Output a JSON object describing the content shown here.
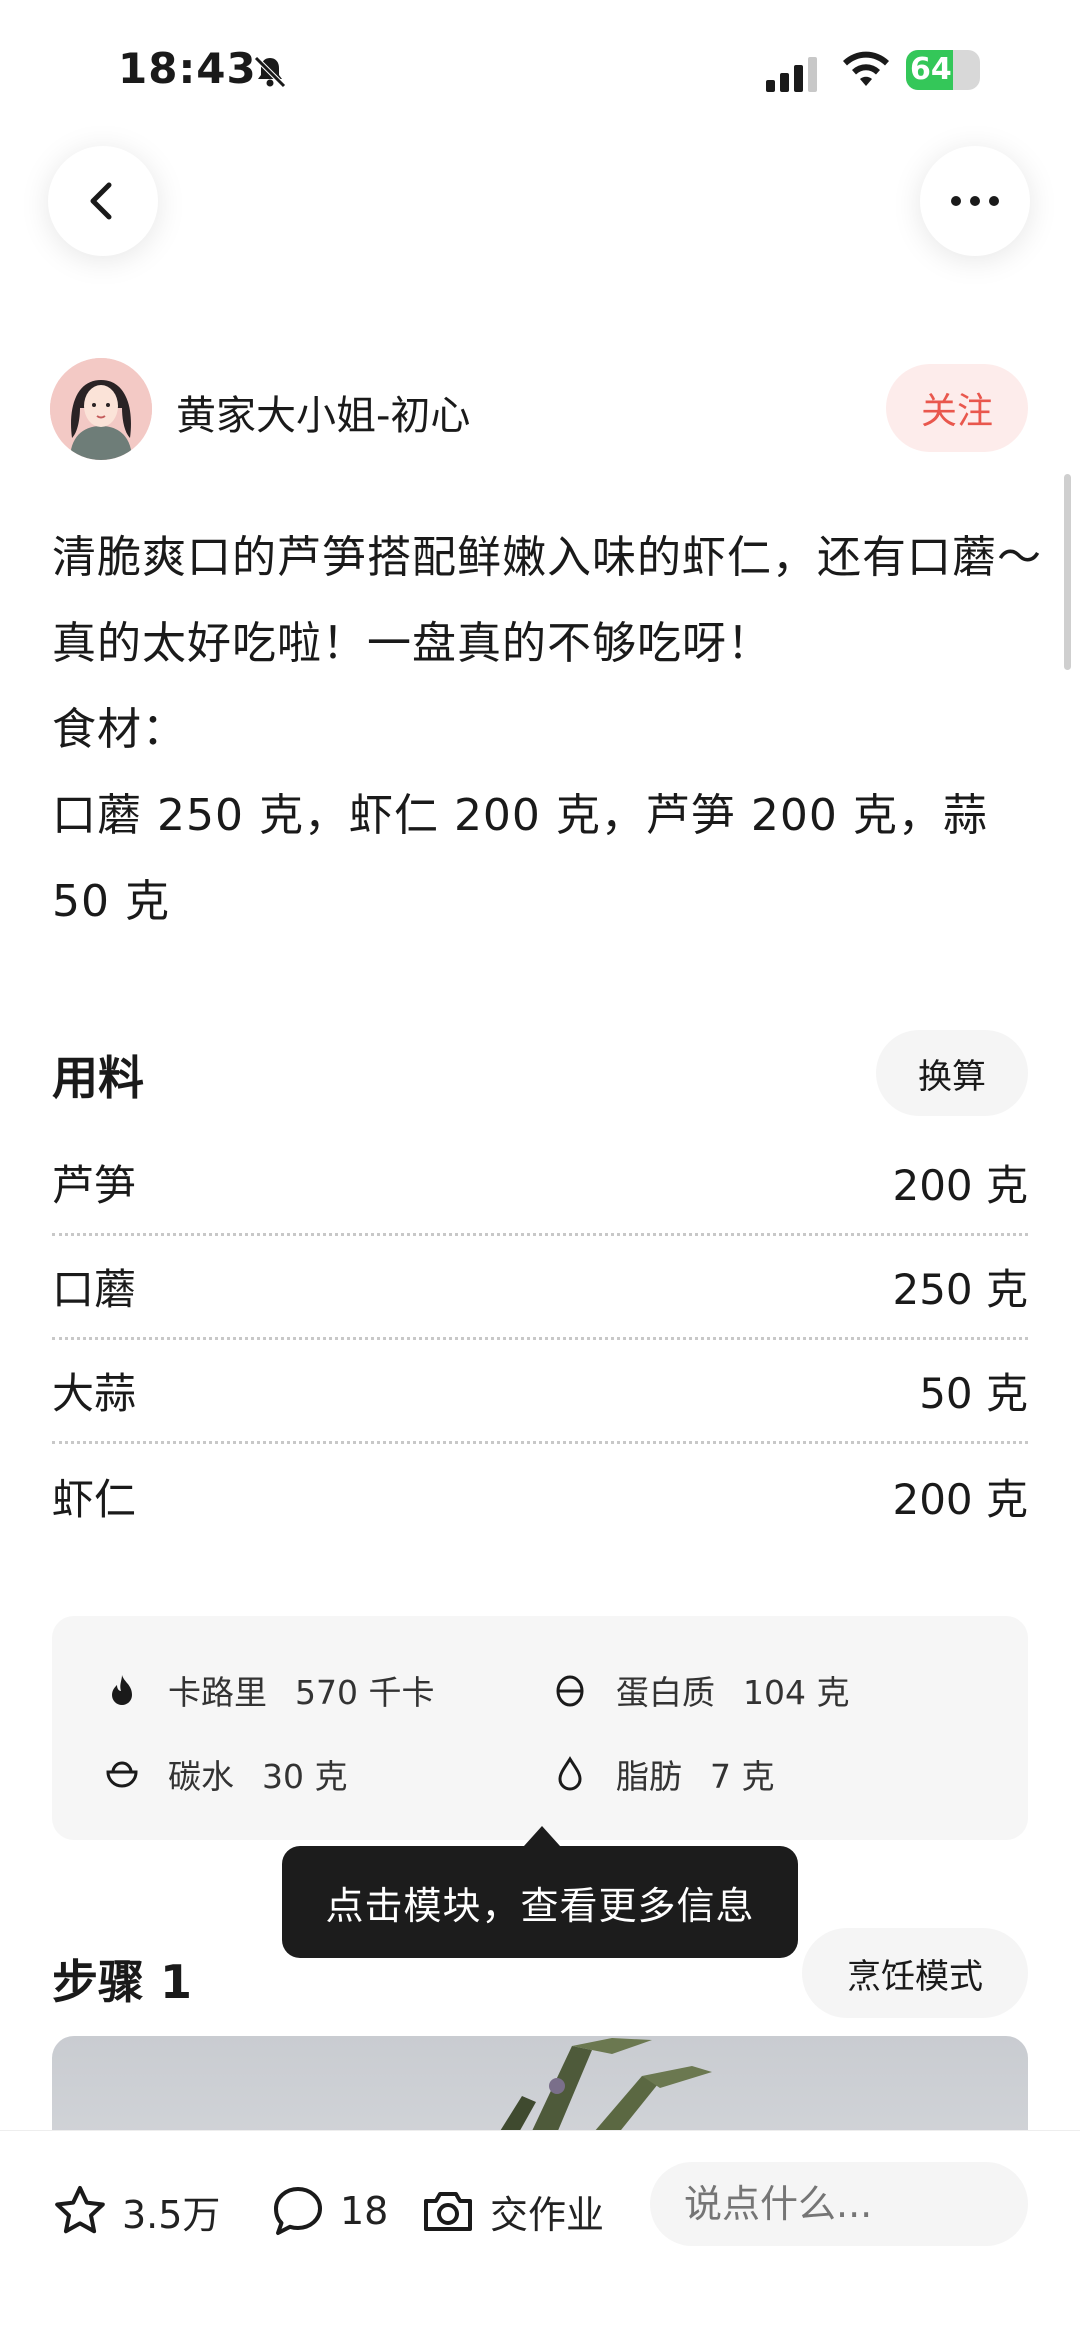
{
  "status_bar": {
    "time": "18:43",
    "battery": "64",
    "battery_level": 0.64
  },
  "author": {
    "name": "黄家大小姐-初心",
    "follow_label": "关注"
  },
  "description": {
    "lines": [
      "清脆爽口的芦笋搭配鲜嫩入味的虾仁，还有口蘑～真的太好吃啦！一盘真的不够吃呀！",
      "食材：",
      "口蘑 250 克，虾仁 200 克，芦笋 200 克，蒜 50 克"
    ]
  },
  "ingredients": {
    "title": "用料",
    "convert_label": "换算",
    "items": [
      {
        "name": "芦笋",
        "amount": "200 克"
      },
      {
        "name": "口蘑",
        "amount": "250 克"
      },
      {
        "name": "大蒜",
        "amount": "50 克"
      },
      {
        "name": "虾仁",
        "amount": "200 克"
      }
    ]
  },
  "nutrition": {
    "calories": {
      "label": "卡路里",
      "value": "570 千卡",
      "icon": "flame-icon"
    },
    "protein": {
      "label": "蛋白质",
      "value": "104 克",
      "icon": "egg-icon"
    },
    "carbs": {
      "label": "碳水",
      "value": "30 克",
      "icon": "bowl-icon"
    },
    "fat": {
      "label": "脂肪",
      "value": "7 克",
      "icon": "drop-icon"
    }
  },
  "tooltip": {
    "text": "点击模块，查看更多信息"
  },
  "step": {
    "title": "步骤 1",
    "cook_mode_label": "烹饪模式"
  },
  "bottom_bar": {
    "favorites": "3.5万",
    "comments": "18",
    "homework_label": "交作业",
    "comment_placeholder": "说点什么..."
  },
  "colors": {
    "accent": "#e9574d",
    "follow_bg": "#fdeceb",
    "tooltip_bg": "#1c1c1c",
    "battery": "#34c759"
  }
}
